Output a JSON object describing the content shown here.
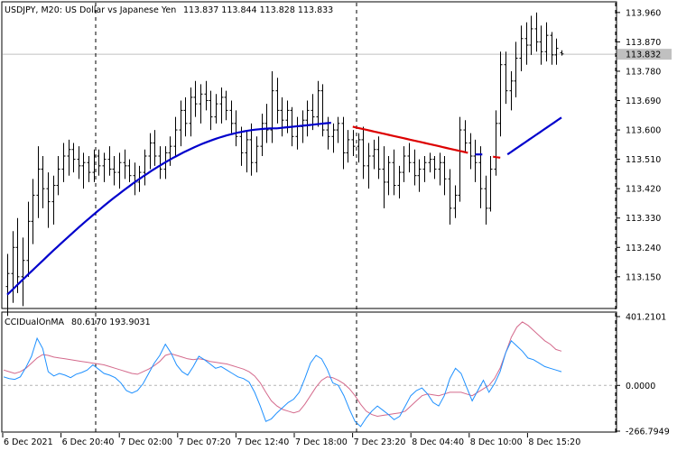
{
  "chart_data": {
    "type": "candlestick",
    "symbol_info": "USDJPY, M20:  US Dollar vs Japanese Yen",
    "ohlc_readout": "113.837 113.844 113.828 113.833",
    "current_price_label": "113.832",
    "price_axis": {
      "range": [
        113.05,
        113.99
      ],
      "tick_labels": [
        "113.960",
        "113.870",
        "113.780",
        "113.690",
        "113.600",
        "113.510",
        "113.420",
        "113.330",
        "113.240",
        "113.150"
      ]
    },
    "time_axis": {
      "tick_labels": [
        "6 Dec 2021",
        "6 Dec 20:40",
        "7 Dec 02:00",
        "7 Dec 07:20",
        "7 Dec 12:40",
        "7 Dec 18:00",
        "7 Dec 23:20",
        "8 Dec 04:40",
        "8 Dec 10:00",
        "8 Dec 15:20"
      ]
    },
    "candles": [
      [
        113.12,
        113.22,
        113.03,
        113.16
      ],
      [
        113.16,
        113.29,
        113.07,
        113.24
      ],
      [
        113.24,
        113.33,
        113.1,
        113.15
      ],
      [
        113.15,
        113.27,
        113.06,
        113.2
      ],
      [
        113.2,
        113.38,
        113.15,
        113.32
      ],
      [
        113.32,
        113.45,
        113.25,
        113.4
      ],
      [
        113.4,
        113.55,
        113.33,
        113.48
      ],
      [
        113.48,
        113.52,
        113.36,
        113.42
      ],
      [
        113.42,
        113.47,
        113.3,
        113.38
      ],
      [
        113.38,
        113.46,
        113.31,
        113.43
      ],
      [
        113.43,
        113.52,
        113.4,
        113.48
      ],
      [
        113.48,
        113.56,
        113.44,
        113.52
      ],
      [
        113.52,
        113.57,
        113.46,
        113.54
      ],
      [
        113.54,
        113.56,
        113.47,
        113.51
      ],
      [
        113.51,
        113.55,
        113.45,
        113.49
      ],
      [
        113.49,
        113.53,
        113.42,
        113.5
      ],
      [
        113.5,
        113.52,
        113.44,
        113.47
      ],
      [
        113.47,
        113.54,
        113.44,
        113.52
      ],
      [
        113.52,
        113.54,
        113.46,
        113.49
      ],
      [
        113.49,
        113.53,
        113.44,
        113.51
      ],
      [
        113.51,
        113.55,
        113.46,
        113.48
      ],
      [
        113.48,
        113.52,
        113.43,
        113.47
      ],
      [
        113.47,
        113.53,
        113.42,
        113.5
      ],
      [
        113.5,
        113.54,
        113.45,
        113.49
      ],
      [
        113.49,
        113.51,
        113.44,
        113.46
      ],
      [
        113.46,
        113.5,
        113.4,
        113.44
      ],
      [
        113.44,
        113.49,
        113.41,
        113.47
      ],
      [
        113.47,
        113.54,
        113.43,
        113.52
      ],
      [
        113.52,
        113.59,
        113.48,
        113.56
      ],
      [
        113.56,
        113.6,
        113.49,
        113.52
      ],
      [
        113.52,
        113.55,
        113.45,
        113.48
      ],
      [
        113.48,
        113.55,
        113.45,
        113.53
      ],
      [
        113.53,
        113.58,
        113.49,
        113.55
      ],
      [
        113.55,
        113.64,
        113.52,
        113.6
      ],
      [
        113.6,
        113.69,
        113.55,
        113.66
      ],
      [
        113.66,
        113.7,
        113.58,
        113.62
      ],
      [
        113.62,
        113.73,
        113.58,
        113.7
      ],
      [
        113.7,
        113.75,
        113.64,
        113.68
      ],
      [
        113.68,
        113.74,
        113.62,
        113.71
      ],
      [
        113.71,
        113.75,
        113.66,
        113.69
      ],
      [
        113.69,
        113.72,
        113.6,
        113.64
      ],
      [
        113.64,
        113.71,
        113.62,
        113.68
      ],
      [
        113.68,
        113.73,
        113.62,
        113.7
      ],
      [
        113.7,
        113.72,
        113.63,
        113.66
      ],
      [
        113.66,
        113.69,
        113.59,
        113.62
      ],
      [
        113.62,
        113.66,
        113.55,
        113.58
      ],
      [
        113.58,
        113.61,
        113.49,
        113.53
      ],
      [
        113.53,
        113.6,
        113.47,
        113.57
      ],
      [
        113.57,
        113.62,
        113.46,
        113.5
      ],
      [
        113.5,
        113.58,
        113.47,
        113.55
      ],
      [
        113.55,
        113.65,
        113.52,
        113.62
      ],
      [
        113.62,
        113.68,
        113.56,
        113.6
      ],
      [
        113.6,
        113.78,
        113.56,
        113.72
      ],
      [
        113.72,
        113.76,
        113.62,
        113.66
      ],
      [
        113.66,
        113.7,
        113.58,
        113.63
      ],
      [
        113.63,
        113.69,
        113.59,
        113.66
      ],
      [
        113.66,
        113.67,
        113.55,
        113.58
      ],
      [
        113.58,
        113.64,
        113.54,
        113.61
      ],
      [
        113.61,
        113.66,
        113.56,
        113.63
      ],
      [
        113.63,
        113.69,
        113.58,
        113.66
      ],
      [
        113.66,
        113.71,
        113.6,
        113.64
      ],
      [
        113.64,
        113.75,
        113.61,
        113.72
      ],
      [
        113.72,
        113.74,
        113.58,
        113.6
      ],
      [
        113.6,
        113.64,
        113.54,
        113.58
      ],
      [
        113.58,
        113.62,
        113.53,
        113.6
      ],
      [
        113.6,
        113.64,
        113.56,
        113.62
      ],
      [
        113.62,
        113.64,
        113.48,
        113.53
      ],
      [
        113.53,
        113.6,
        113.5,
        113.57
      ],
      [
        113.57,
        113.6,
        113.52,
        113.55
      ],
      [
        113.55,
        113.59,
        113.5,
        113.57
      ],
      [
        113.57,
        113.61,
        113.45,
        113.49
      ],
      [
        113.49,
        113.56,
        113.42,
        113.52
      ],
      [
        113.52,
        113.57,
        113.48,
        113.54
      ],
      [
        113.54,
        113.58,
        113.45,
        113.48
      ],
      [
        113.48,
        113.55,
        113.36,
        113.44
      ],
      [
        113.44,
        113.52,
        113.4,
        113.5
      ],
      [
        113.5,
        113.54,
        113.4,
        113.43
      ],
      [
        113.43,
        113.49,
        113.39,
        113.47
      ],
      [
        113.47,
        113.55,
        113.44,
        113.52
      ],
      [
        113.52,
        113.56,
        113.47,
        113.5
      ],
      [
        113.5,
        113.54,
        113.43,
        113.46
      ],
      [
        113.46,
        113.51,
        113.41,
        113.48
      ],
      [
        113.48,
        113.52,
        113.44,
        113.5
      ],
      [
        113.5,
        113.53,
        113.47,
        113.51
      ],
      [
        113.51,
        113.52,
        113.45,
        113.48
      ],
      [
        113.48,
        113.53,
        113.43,
        113.5
      ],
      [
        113.5,
        113.52,
        113.4,
        113.45
      ],
      [
        113.45,
        113.48,
        113.31,
        113.36
      ],
      [
        113.36,
        113.43,
        113.33,
        113.4
      ],
      [
        113.4,
        113.64,
        113.38,
        113.6
      ],
      [
        113.6,
        113.63,
        113.53,
        113.56
      ],
      [
        113.56,
        113.59,
        113.48,
        113.52
      ],
      [
        113.52,
        113.57,
        113.44,
        113.5
      ],
      [
        113.5,
        113.55,
        113.36,
        113.42
      ],
      [
        113.42,
        113.46,
        113.31,
        113.36
      ],
      [
        113.36,
        113.52,
        113.35,
        113.48
      ],
      [
        113.48,
        113.66,
        113.46,
        113.62
      ],
      [
        113.62,
        113.84,
        113.58,
        113.8
      ],
      [
        113.8,
        113.84,
        113.68,
        113.72
      ],
      [
        113.72,
        113.78,
        113.66,
        113.75
      ],
      [
        113.75,
        113.87,
        113.7,
        113.82
      ],
      [
        113.82,
        113.92,
        113.78,
        113.88
      ],
      [
        113.88,
        113.93,
        113.8,
        113.86
      ],
      [
        113.86,
        113.95,
        113.83,
        113.91
      ],
      [
        113.91,
        113.96,
        113.84,
        113.87
      ],
      [
        113.87,
        113.92,
        113.8,
        113.84
      ],
      [
        113.84,
        113.93,
        113.81,
        113.89
      ],
      [
        113.89,
        113.9,
        113.8,
        113.83
      ],
      [
        113.83,
        113.88,
        113.8,
        113.85
      ],
      [
        113.837,
        113.844,
        113.828,
        113.833
      ]
    ],
    "ma_line": {
      "color_up": "#0000cc",
      "color_down": "#dd0000",
      "segments": [
        {
          "color": "blue",
          "from_index": 0,
          "to_index": 75,
          "start": 113.095,
          "end": 113.605
        },
        {
          "color": "blue",
          "from_index": 75,
          "to_index": 90,
          "start": 113.605,
          "end": 113.622
        },
        {
          "color": "red",
          "from_index": 96,
          "to_index": 128,
          "start": 113.61,
          "end": 113.53
        },
        {
          "color": "blue",
          "from_index": 130,
          "to_index": 132,
          "start": 113.525,
          "end": 113.525
        },
        {
          "color": "red",
          "from_index": 135,
          "to_index": 137,
          "start": 113.518,
          "end": 113.515
        },
        {
          "color": "blue",
          "from_index": 139,
          "to_index": 154,
          "start": 113.525,
          "end": 113.638
        }
      ]
    },
    "indicator": {
      "name": "CCIDualOnMA",
      "values_readout": "80.6170 193.9031",
      "range": [
        -266.7949,
        401.2101
      ],
      "tick_labels": [
        "401.2101",
        "0.0000",
        "-266.7949"
      ],
      "zero_level": 0,
      "fast_line": {
        "color": "#1e90ff",
        "values": [
          50,
          40,
          35,
          50,
          105,
          170,
          275,
          215,
          80,
          55,
          70,
          60,
          45,
          65,
          75,
          90,
          120,
          95,
          70,
          60,
          45,
          15,
          -30,
          -45,
          -30,
          10,
          70,
          130,
          175,
          240,
          190,
          120,
          80,
          60,
          110,
          170,
          150,
          125,
          100,
          110,
          90,
          70,
          50,
          40,
          20,
          -40,
          -120,
          -210,
          -195,
          -160,
          -130,
          -100,
          -80,
          -40,
          40,
          130,
          175,
          155,
          95,
          15,
          0,
          -60,
          -140,
          -210,
          -240,
          -190,
          -150,
          -120,
          -145,
          -170,
          -200,
          -180,
          -120,
          -60,
          -30,
          -15,
          -50,
          -100,
          -120,
          -60,
          40,
          100,
          70,
          -10,
          -90,
          -30,
          30,
          -40,
          10,
          80,
          190,
          260,
          230,
          200,
          160,
          150,
          130,
          110,
          100,
          90,
          80
        ]
      },
      "slow_line": {
        "color": "#d46a8c",
        "values": [
          90,
          80,
          70,
          80,
          100,
          130,
          160,
          180,
          175,
          165,
          160,
          155,
          150,
          145,
          140,
          135,
          130,
          125,
          120,
          110,
          100,
          90,
          80,
          70,
          65,
          80,
          95,
          115,
          140,
          175,
          185,
          175,
          165,
          155,
          150,
          155,
          150,
          140,
          135,
          130,
          125,
          115,
          105,
          95,
          80,
          55,
          15,
          -40,
          -90,
          -120,
          -140,
          -150,
          -160,
          -150,
          -110,
          -60,
          -10,
          30,
          50,
          45,
          30,
          10,
          -20,
          -60,
          -110,
          -150,
          -170,
          -180,
          -175,
          -170,
          -165,
          -160,
          -150,
          -120,
          -90,
          -60,
          -50,
          -55,
          -60,
          -50,
          -40,
          -40,
          -40,
          -50,
          -60,
          -40,
          -20,
          0,
          40,
          100,
          190,
          280,
          340,
          370,
          350,
          320,
          290,
          260,
          240,
          210,
          200
        ]
      }
    },
    "grid": "vertical dashed lines at day boundaries",
    "legend": "none"
  }
}
